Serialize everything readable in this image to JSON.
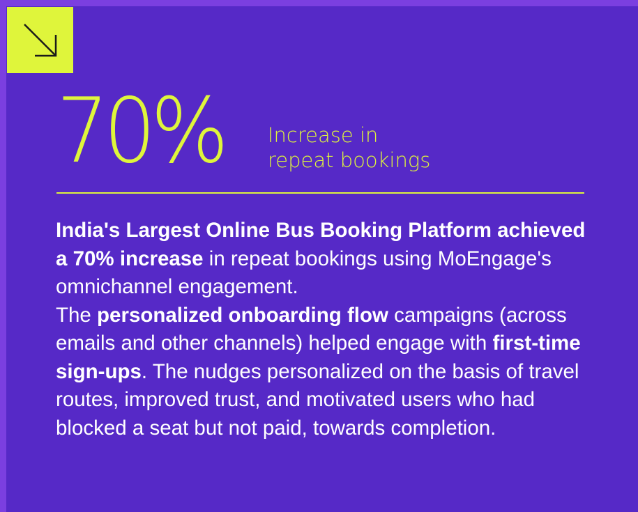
{
  "colors": {
    "frame": "#7b3fe0",
    "background": "#5629c7",
    "accent": "#dff53b",
    "text": "#ffffff"
  },
  "icon": "arrow-down-right-icon",
  "stat": {
    "value": "70%",
    "caption_line1": "Increase in",
    "caption_line2": "repeat bookings"
  },
  "body": {
    "p1_bold": "India's Largest Online Bus Booking Platform achieved a 70% increase",
    "p1_rest": " in repeat bookings using MoEngage's omnichannel engagement.",
    "p2_start": "The ",
    "p2_bold1": "personalized onboarding flow",
    "p2_mid": " campaigns (across emails and other channels) helped engage with ",
    "p2_bold2": "first-time sign-ups",
    "p2_end": ". The nudges personalized on the  basis of travel routes, improved trust, and motivated users who had blocked a seat but not paid, towards completion."
  }
}
